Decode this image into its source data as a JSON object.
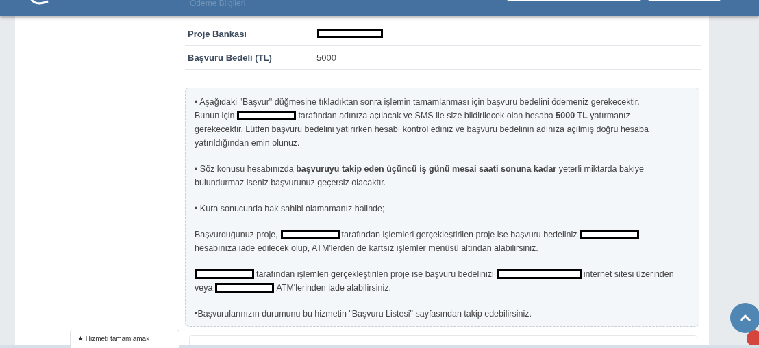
{
  "header": {
    "section_title": "Ödeme Bilgileri"
  },
  "info_rows": [
    {
      "label": "Proje Bankası",
      "kind": "redacted"
    },
    {
      "label": "Başvuru Bedeli (TL)",
      "kind": "text",
      "value": "5000"
    }
  ],
  "notice": {
    "paragraphs": [
      [
        [
          {
            "kind": "text",
            "text": "• Aşağıdaki \"Başvur\" düğmesine tıkladıktan sonra işlemin tamamlanması için başvuru bedelini ödemeniz gerekecektir."
          }
        ],
        [
          {
            "kind": "text",
            "text": "Bunun için"
          },
          {
            "kind": "redacted"
          },
          {
            "kind": "text",
            "text": "tarafından adınıza açılacak ve SMS ile size bildirilecek olan hesaba **5000 TL** yatırmanız"
          }
        ],
        [
          {
            "kind": "text",
            "text": "gerekecektir. Lütfen başvuru bedelini yatırırken hesabı kontrol ediniz ve başvuru bedelinin adınıza açılmış doğru hesaba"
          }
        ],
        [
          {
            "kind": "text",
            "text": "yatırıldığından emin olunuz."
          }
        ]
      ],
      [
        [
          {
            "kind": "text",
            "text": "• Söz konusu hesabınızda **başvuruyu takip eden üçüncü iş günü mesai saati sonuna kadar** yeterli miktarda bakiye"
          }
        ],
        [
          {
            "kind": "text",
            "text": "bulundurmaz iseniz başvurunuz geçersiz olacaktır."
          }
        ]
      ],
      [
        [
          {
            "kind": "text",
            "text": "• Kura sonucunda hak sahibi olamamanız halinde;"
          }
        ]
      ],
      [
        [
          {
            "kind": "text",
            "text": "Başvurduğunuz proje,"
          },
          {
            "kind": "redacted"
          },
          {
            "kind": "text",
            "text": "tarafından işlemleri gerçekleştirilen proje ise başvuru bedeliniz"
          },
          {
            "kind": "redacted"
          }
        ],
        [
          {
            "kind": "text",
            "text": "hesabınıza iade edilecek olup, ATM'lerden de kartsız işlemler menüsü altından alabilirsiniz."
          }
        ]
      ],
      [
        [
          {
            "kind": "redacted"
          },
          {
            "kind": "text",
            "text": "tarafından işlemleri gerçekleştirilen proje ise başvuru bedelinizi"
          },
          {
            "kind": "redacted_long"
          },
          {
            "kind": "text",
            "text": "internet sitesi üzerinden"
          }
        ],
        [
          {
            "kind": "text",
            "text": "veya"
          },
          {
            "kind": "redacted"
          },
          {
            "kind": "text",
            "text": "ATM'lerinden iade alabilirsiniz."
          }
        ]
      ],
      [
        [
          {
            "kind": "text",
            "text": "•Başvurularınızın durumunu bu hizmetin \"Başvuru Listesi\" sayfasından takip edebilirsiniz."
          }
        ]
      ]
    ]
  },
  "sidebar_card": {
    "label": "★ Hizmeti tamamlamak"
  }
}
